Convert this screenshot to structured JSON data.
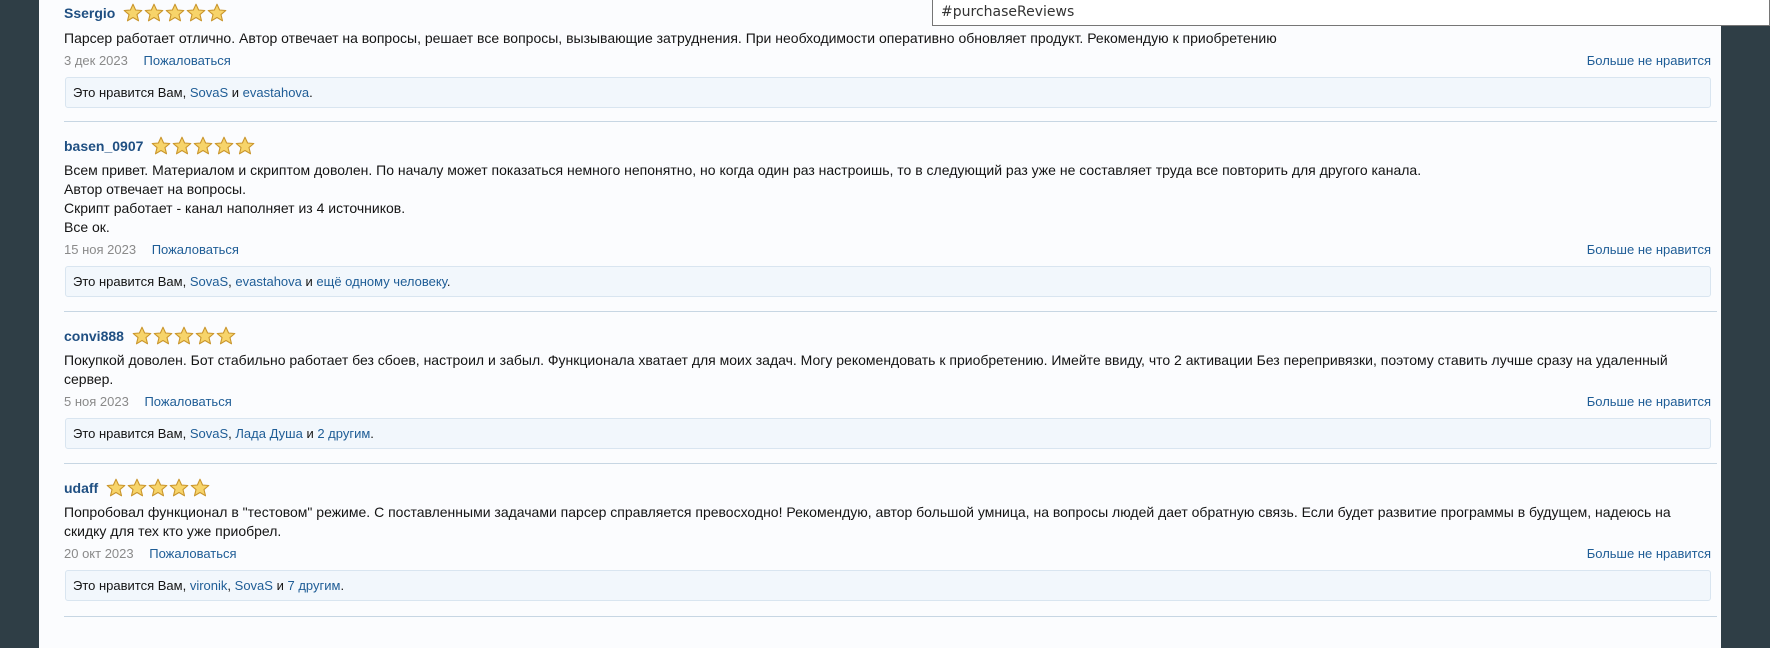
{
  "tooltip": "#purchaseReviews",
  "unlike_label": "Больше не нравится",
  "report_label": "Пожаловаться",
  "likes_prefix": "Это нравится Вам,",
  "reviews": [
    {
      "author": "Ssergio",
      "rating": 5,
      "lines": [
        "Парсер работает отлично. Автор отвечает на вопросы, решает все вопросы, вызывающие затруднения. При необходимости оперативно обновляет продукт. Рекомендую к приобретению"
      ],
      "date": "3 дек 2023",
      "likers": [
        "SovaS",
        "evastahova"
      ],
      "likes_sep": ",",
      "likes_and": "и",
      "likes_tail": "."
    },
    {
      "author": "basen_0907",
      "rating": 5,
      "lines": [
        "Всем привет. Материалом и скриптом доволен. По началу может показаться немного непонятно, но когда один раз настроишь, то в следующий раз уже не составляет труда все повторить для другого канала.",
        "Автор отвечает на вопросы.",
        "Скрипт работает - канал наполняет из 4 источников.",
        "Все ок."
      ],
      "date": "15 ноя 2023",
      "likers": [
        "SovaS",
        "evastahova",
        "ещё одному человеку"
      ],
      "likes_and": "и",
      "likes_tail": "."
    },
    {
      "author": "convi888",
      "rating": 5,
      "lines": [
        "Покупкой доволен. Бот стабильно работает без сбоев, настроил и забыл. Функционала хватает для моих задач. Могу рекомендовать к приобретению. Имейте ввиду, что 2 активации Без перепривязки, поэтому ставить лучше сразу на удаленный сервер."
      ],
      "date": "5 ноя 2023",
      "likers": [
        "SovaS",
        "Лада Душа",
        "2 другим"
      ],
      "likes_and": "и",
      "likes_tail": "."
    },
    {
      "author": "udaff",
      "rating": 5,
      "lines": [
        "Попробовал функционал в \"тестовом\" режиме. С поставленными задачами парсер справляется превосходно! Рекомендую, автор большой умница, на вопросы людей дает обратную связь. Если будет развитие программы в будущем, надеюсь на скидку для тех кто уже приобрел."
      ],
      "date": "20 окт 2023",
      "likers": [
        "vironik",
        "SovaS",
        "7 другим"
      ],
      "likes_and": "и",
      "likes_tail": "."
    }
  ]
}
